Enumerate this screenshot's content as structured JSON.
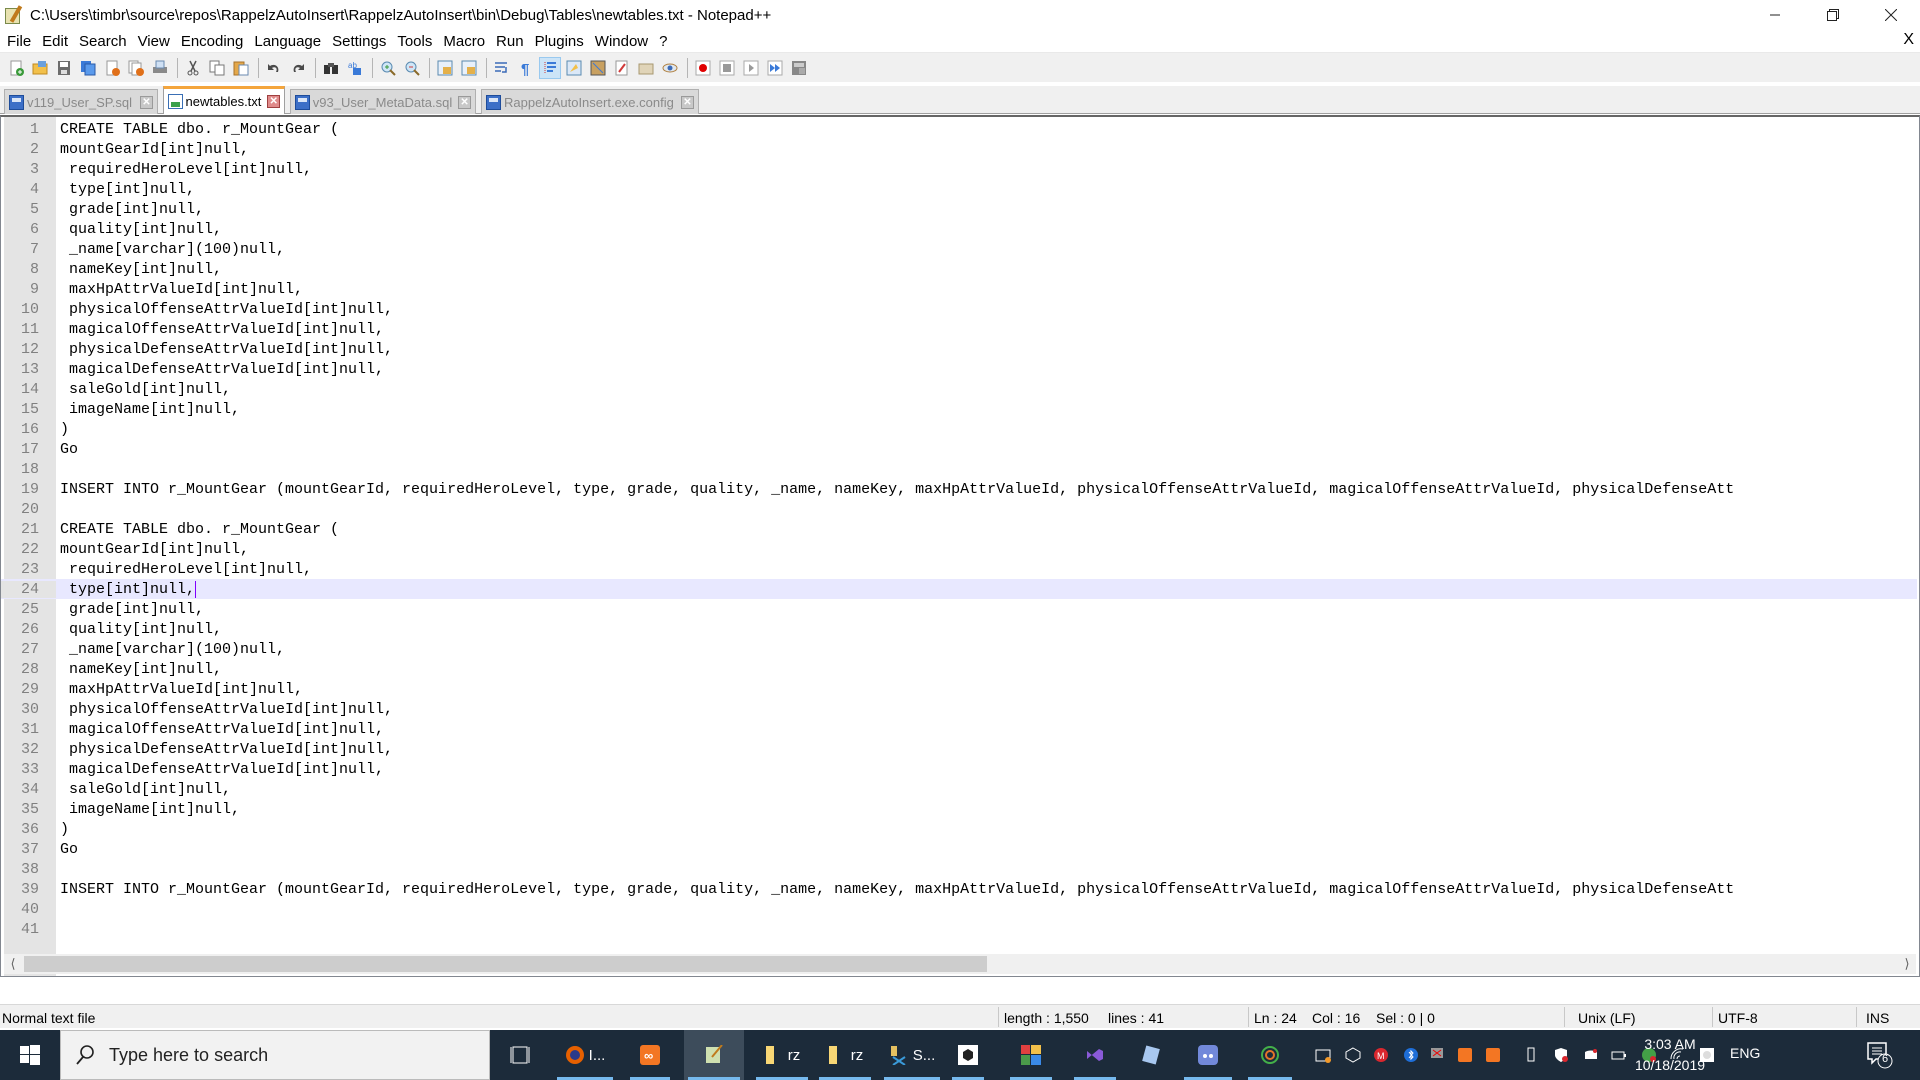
{
  "window": {
    "title": "C:\\Users\\timbr\\source\\repos\\RappelzAutoInsert\\RappelzAutoInsert\\bin\\Debug\\Tables\\newtables.txt - Notepad++",
    "controls": {
      "minimize": "minimize",
      "maximize": "restore",
      "close": "close"
    }
  },
  "menu": {
    "items": [
      "File",
      "Edit",
      "Search",
      "View",
      "Encoding",
      "Language",
      "Settings",
      "Tools",
      "Macro",
      "Run",
      "Plugins",
      "Window",
      "?"
    ],
    "close_doc": "X"
  },
  "toolbar": {
    "buttons": [
      {
        "name": "new-file",
        "icon": "new-file-icon"
      },
      {
        "name": "open-file",
        "icon": "open-folder-icon"
      },
      {
        "name": "save",
        "icon": "save-icon"
      },
      {
        "name": "save-all",
        "icon": "save-all-icon"
      },
      {
        "name": "close",
        "icon": "close-file-icon"
      },
      {
        "name": "close-all",
        "icon": "close-all-icon"
      },
      {
        "name": "print",
        "icon": "print-icon"
      },
      {
        "name": "cut",
        "icon": "cut-icon"
      },
      {
        "name": "copy",
        "icon": "copy-icon"
      },
      {
        "name": "paste",
        "icon": "paste-icon"
      },
      {
        "name": "undo",
        "icon": "undo-icon"
      },
      {
        "name": "redo",
        "icon": "redo-icon"
      },
      {
        "name": "find",
        "icon": "binoculars-icon"
      },
      {
        "name": "replace",
        "icon": "replace-icon"
      },
      {
        "name": "zoom-in",
        "icon": "zoom-in-icon"
      },
      {
        "name": "zoom-out",
        "icon": "zoom-out-icon"
      },
      {
        "name": "sync-vertical",
        "icon": "sync-vertical-icon"
      },
      {
        "name": "sync-horizontal",
        "icon": "sync-horizontal-icon"
      },
      {
        "name": "word-wrap",
        "icon": "word-wrap-icon"
      },
      {
        "name": "show-all-chars",
        "icon": "pilcrow-icon"
      },
      {
        "name": "indent-guide",
        "icon": "indent-guide-icon",
        "active": true
      },
      {
        "name": "user-defined-language",
        "icon": "udl-icon"
      },
      {
        "name": "document-map",
        "icon": "document-map-icon"
      },
      {
        "name": "function-list",
        "icon": "function-list-icon"
      },
      {
        "name": "folder-as-workspace",
        "icon": "folder-icon"
      },
      {
        "name": "monitoring",
        "icon": "eye-icon"
      },
      {
        "name": "macro-record",
        "icon": "record-icon"
      },
      {
        "name": "macro-stop",
        "icon": "stop-icon"
      },
      {
        "name": "macro-play",
        "icon": "play-icon"
      },
      {
        "name": "macro-run-multiple",
        "icon": "fast-forward-icon"
      },
      {
        "name": "macro-save",
        "icon": "save-macro-icon"
      }
    ]
  },
  "tabs": [
    {
      "label": "v119_User_SP.sql",
      "active": false
    },
    {
      "label": "newtables.txt",
      "active": true
    },
    {
      "label": "v93_User_MetaData.sql",
      "active": false
    },
    {
      "label": "RappelzAutoInsert.exe.config",
      "active": false
    }
  ],
  "editor": {
    "current_line": 24,
    "lines": [
      "CREATE TABLE dbo. r_MountGear (",
      "mountGearId[int]null,",
      " requiredHeroLevel[int]null,",
      " type[int]null,",
      " grade[int]null,",
      " quality[int]null,",
      " _name[varchar](100)null,",
      " nameKey[int]null,",
      " maxHpAttrValueId[int]null,",
      " physicalOffenseAttrValueId[int]null,",
      " magicalOffenseAttrValueId[int]null,",
      " physicalDefenseAttrValueId[int]null,",
      " magicalDefenseAttrValueId[int]null,",
      " saleGold[int]null,",
      " imageName[int]null,",
      ")",
      "Go",
      "",
      "INSERT INTO r_MountGear (mountGearId, requiredHeroLevel, type, grade, quality, _name, nameKey, maxHpAttrValueId, physicalOffenseAttrValueId, magicalOffenseAttrValueId, physicalDefenseAtt",
      "",
      "CREATE TABLE dbo. r_MountGear (",
      "mountGearId[int]null,",
      " requiredHeroLevel[int]null,",
      " type[int]null,",
      " grade[int]null,",
      " quality[int]null,",
      " _name[varchar](100)null,",
      " nameKey[int]null,",
      " maxHpAttrValueId[int]null,",
      " physicalOffenseAttrValueId[int]null,",
      " magicalOffenseAttrValueId[int]null,",
      " physicalDefenseAttrValueId[int]null,",
      " magicalDefenseAttrValueId[int]null,",
      " saleGold[int]null,",
      " imageName[int]null,",
      ")",
      "Go",
      "",
      "INSERT INTO r_MountGear (mountGearId, requiredHeroLevel, type, grade, quality, _name, nameKey, maxHpAttrValueId, physicalOffenseAttrValueId, magicalOffenseAttrValueId, physicalDefenseAtt",
      "",
      ""
    ]
  },
  "statusbar": {
    "file_type": "Normal text file",
    "length": "length : 1,550",
    "lines": "lines : 41",
    "ln": "Ln : 24",
    "col": "Col : 16",
    "sel": "Sel : 0 | 0",
    "eol": "Unix (LF)",
    "encoding": "UTF-8",
    "mode": "INS"
  },
  "taskbar": {
    "search_placeholder": "Type here to search",
    "apps": [
      {
        "name": "task-view",
        "label": ""
      },
      {
        "name": "firefox",
        "label": "I..."
      },
      {
        "name": "xampp",
        "label": ""
      },
      {
        "name": "notepad-plus-plus",
        "label": ""
      },
      {
        "name": "file-explorer-1",
        "label": "rz"
      },
      {
        "name": "file-explorer-2",
        "label": "rz"
      },
      {
        "name": "sql-server",
        "label": "S..."
      },
      {
        "name": "unity",
        "label": ""
      },
      {
        "name": "app-tiles",
        "label": ""
      },
      {
        "name": "visual-studio",
        "label": ""
      },
      {
        "name": "notepad",
        "label": ""
      },
      {
        "name": "discord",
        "label": ""
      },
      {
        "name": "anaconda",
        "label": ""
      }
    ],
    "language": "ENG",
    "time": "3:03 AM",
    "date": "10/18/2019",
    "notification_count": "6"
  },
  "colors": {
    "active_tab_accent": "#f4a53c",
    "current_line_bg": "#e8e8ff",
    "caret": "#8000ff",
    "taskbar_bg": "#1c2b3a",
    "taskbar_running_indicator": "#76b9ed"
  }
}
